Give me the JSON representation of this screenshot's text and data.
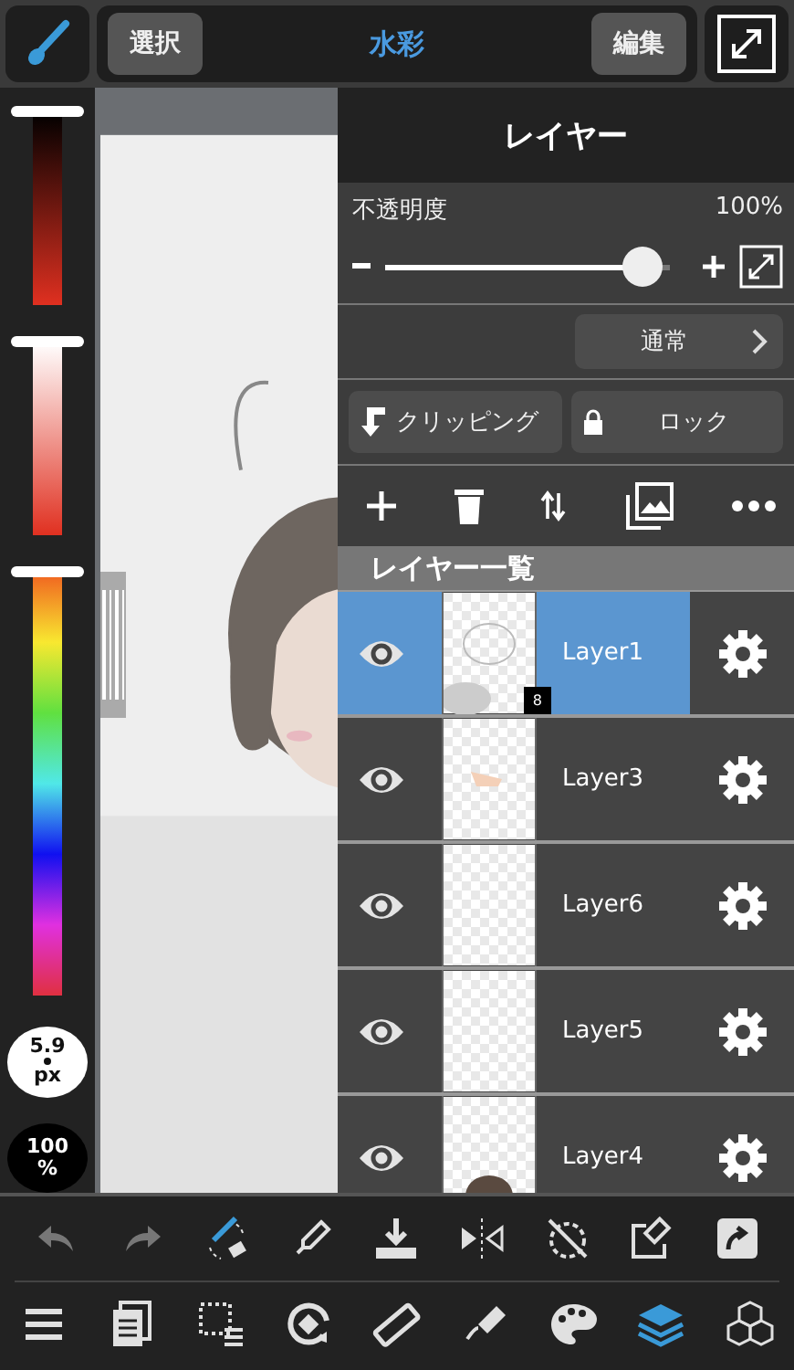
{
  "top_bar": {
    "tool_active": true,
    "select_button": "選択",
    "brush_name": "水彩",
    "edit_button": "編集"
  },
  "color_sliders": [
    {
      "level": 1
    },
    {
      "level": 1
    },
    {
      "level": 1
    }
  ],
  "brush_size": {
    "value": "5.9",
    "unit": "px"
  },
  "brush_opacity": {
    "value": "100",
    "unit": "%"
  },
  "layer_panel": {
    "title": "レイヤー",
    "opacity_label": "不透明度",
    "opacity_value": "100%",
    "opacity": {
      "level": 0.97
    },
    "blend_mode": "通常",
    "clipping_button": "クリッピング",
    "lock_button": "ロック",
    "list_header": "レイヤー一覧",
    "layers": [
      {
        "name": "Layer1",
        "selected": true,
        "visible": true,
        "kind": "sketch",
        "badge": "8"
      },
      {
        "name": "Layer3",
        "selected": false,
        "visible": true,
        "kind": "skin"
      },
      {
        "name": "Layer6",
        "selected": false,
        "visible": true,
        "kind": "empty"
      },
      {
        "name": "Layer5",
        "selected": false,
        "visible": true,
        "kind": "empty"
      },
      {
        "name": "Layer4",
        "selected": false,
        "visible": true,
        "kind": "hair"
      }
    ]
  },
  "bottom_toolbar": {
    "row_1": [
      {
        "disabled": true
      },
      {
        "disabled": true
      },
      {
        "disabled": false
      },
      {
        "disabled": false
      },
      {
        "disabled": false
      },
      {
        "disabled": false
      },
      {
        "disabled": false
      },
      {
        "disabled": false
      },
      {
        "disabled": false
      }
    ],
    "row_2": [
      {
        "selected": false
      },
      {
        "selected": false
      },
      {
        "selected": false
      },
      {
        "selected": false
      },
      {
        "selected": false
      },
      {
        "selected": false
      },
      {
        "selected": false
      },
      {
        "selected": true
      },
      {
        "selected": false
      }
    ]
  }
}
